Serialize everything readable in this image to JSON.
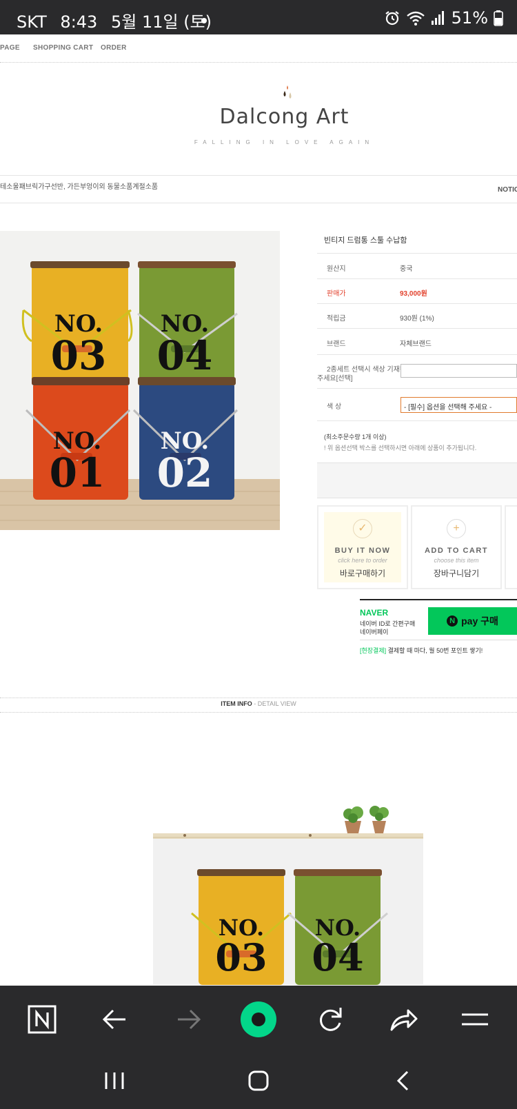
{
  "status": {
    "carrier": "SKT",
    "time": "8:43",
    "date": "5월 11일 (토)",
    "battery": "51%"
  },
  "topnav": {
    "items": [
      "PAGE",
      "SHOPPING CART",
      "ORDER"
    ]
  },
  "logo": {
    "title": "Dalcong Art",
    "subtitle": "FALLING IN LOVE AGAIN"
  },
  "categories": {
    "text": "테소울패브릭가구선반, 가든부엉이외 동물소품계절소품",
    "notice": "NOTIC"
  },
  "product": {
    "title": "빈티지 드럼통 스툴 수납함",
    "rows": [
      {
        "key": "원산지",
        "value": "중국"
      },
      {
        "key": "판매가",
        "value": "93,000원"
      },
      {
        "key": "적립금",
        "value": "930원 (1%)"
      },
      {
        "key": "브랜드",
        "value": "자체브랜드"
      }
    ],
    "option_label_line1": "2종세트 선택시 색상 기재해",
    "option_label_line2": "주세요[선택]",
    "color_label": "색 상",
    "color_select_value": "- [필수] 옵션을 선택해 주세요 -",
    "min_qty": "(최소주문수량 1개 이상)",
    "option_notice": "! 위 옵션선택 박스를 선택하시면 아래에 상품이 추가됩니다."
  },
  "buttons": {
    "buy": {
      "en": "BUY IT NOW",
      "sub": "click here to order",
      "ko": "바로구매하기"
    },
    "cart": {
      "en": "ADD TO CART",
      "sub": "choose this item",
      "ko": "장바구니담기"
    }
  },
  "naver": {
    "logo": "NAVER",
    "line1": "네이버 ID로 간편구매",
    "line2": "네이버페이",
    "pay_label": "pay 구매",
    "promo_highlight": "[현장결제]",
    "promo_text": " 결제할 때 마다, 월 50번 포인트 쌓기!"
  },
  "tabs": {
    "item_info": "ITEM INFO",
    "separator": " - ",
    "detail_view": "DETAIL VIEW"
  },
  "drums": [
    {
      "label": "NO.",
      "number": "03",
      "body": "#e8b024",
      "text": "#111111"
    },
    {
      "label": "NO.",
      "number": "04",
      "body": "#7a9a34",
      "text": "#111111"
    },
    {
      "label": "NO.",
      "number": "01",
      "body": "#dc4a1c",
      "text": "#111111"
    },
    {
      "label": "NO.",
      "number": "02",
      "body": "#2c4a80",
      "text": "#f4f4f4"
    }
  ],
  "detail_drums": [
    {
      "label": "NO.",
      "number": "03"
    },
    {
      "label": "NO.",
      "number": "04"
    }
  ],
  "colors": {
    "npay_green": "#03c75a",
    "price_red": "#e2412c",
    "select_border": "#e07a2c",
    "bar_bg": "#2a2a2c"
  }
}
